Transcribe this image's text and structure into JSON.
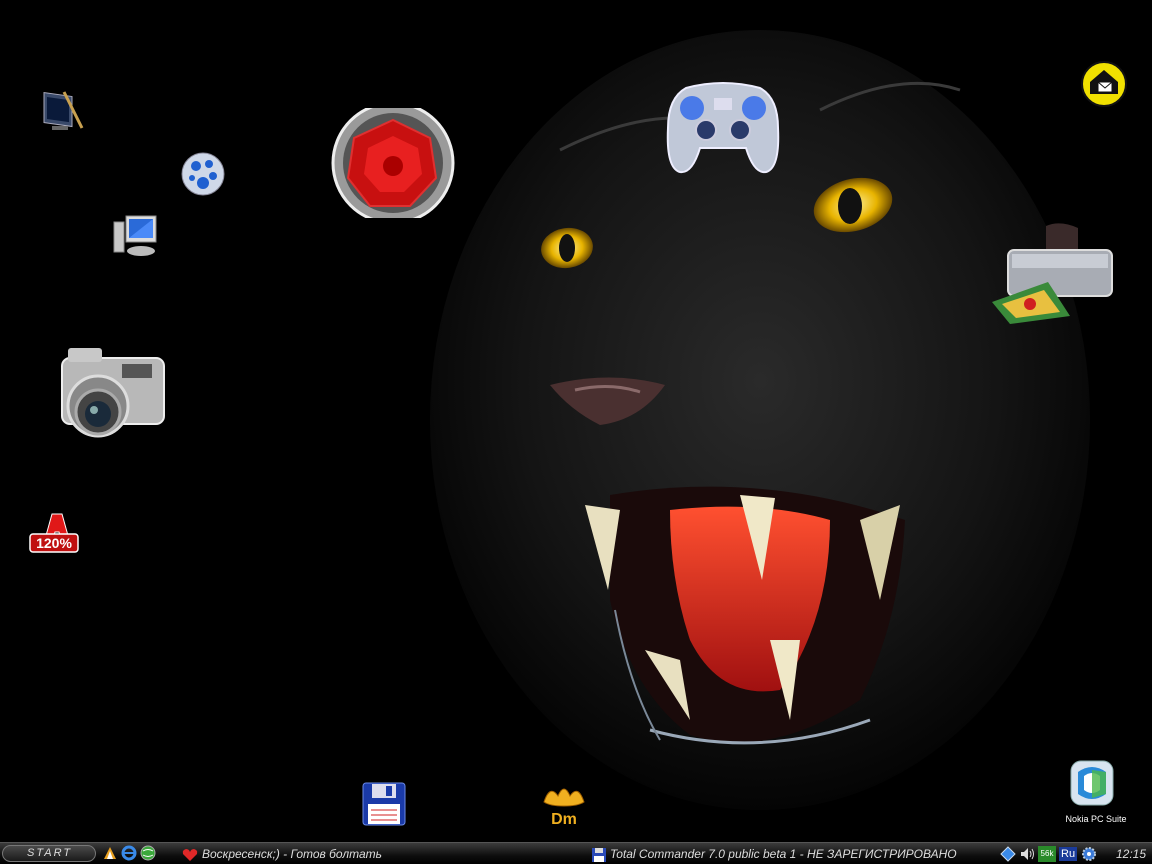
{
  "taskbar": {
    "start_label": "START",
    "tasks": [
      {
        "title": "Воскресенск;) - Готов болтать"
      },
      {
        "title": "Total Commander 7.0 public beta 1 - НЕ ЗАРЕГИСТРИРОВАНО"
      }
    ],
    "tray": {
      "language": "Ru",
      "clock": "12:15",
      "net_badge": "56k"
    }
  },
  "desktop": {
    "icons": [
      {
        "name": "display-properties-icon"
      },
      {
        "name": "globe-app-icon"
      },
      {
        "name": "my-computer-icon"
      },
      {
        "name": "digital-camera-icon"
      },
      {
        "name": "alcohol-120-icon"
      },
      {
        "name": "speaker-icon"
      },
      {
        "name": "gamepad-icon"
      },
      {
        "name": "mail-agent-icon"
      },
      {
        "name": "printer-icon"
      },
      {
        "name": "floppy-disk-icon"
      },
      {
        "name": "download-master-icon"
      },
      {
        "name": "nokia-pc-suite-icon",
        "label": "Nokia PC Suite"
      }
    ],
    "icon_text": {
      "alcohol": "120%",
      "dm": "Dm"
    }
  },
  "colors": {
    "accent_red": "#d42020",
    "eye_yellow": "#e8b400",
    "taskbar": "#1a1a1a"
  }
}
